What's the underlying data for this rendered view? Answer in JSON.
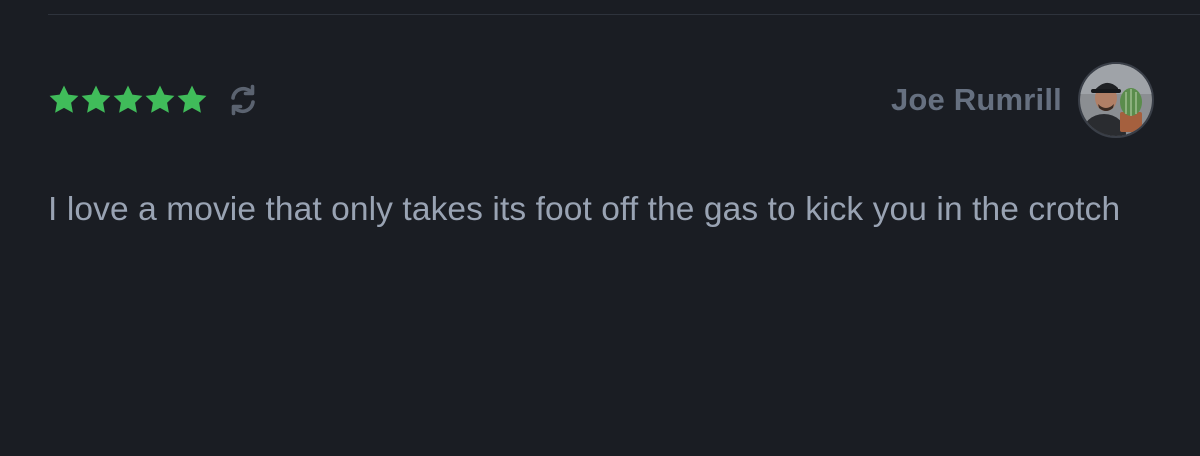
{
  "review": {
    "rating": 5,
    "max_rating": 5,
    "rewatch": true,
    "reviewer_name": "Joe Rumrill",
    "text": "I love a movie that only takes its foot off the gas to kick you in the crotch"
  },
  "icons": {
    "star": "star-icon",
    "rewatch": "rewatch-icon",
    "avatar": "avatar"
  },
  "colors": {
    "background": "#1a1d23",
    "star": "#40bc5a",
    "rewatch": "#5b6370",
    "name": "#667080",
    "body_text": "#99a3b3"
  }
}
